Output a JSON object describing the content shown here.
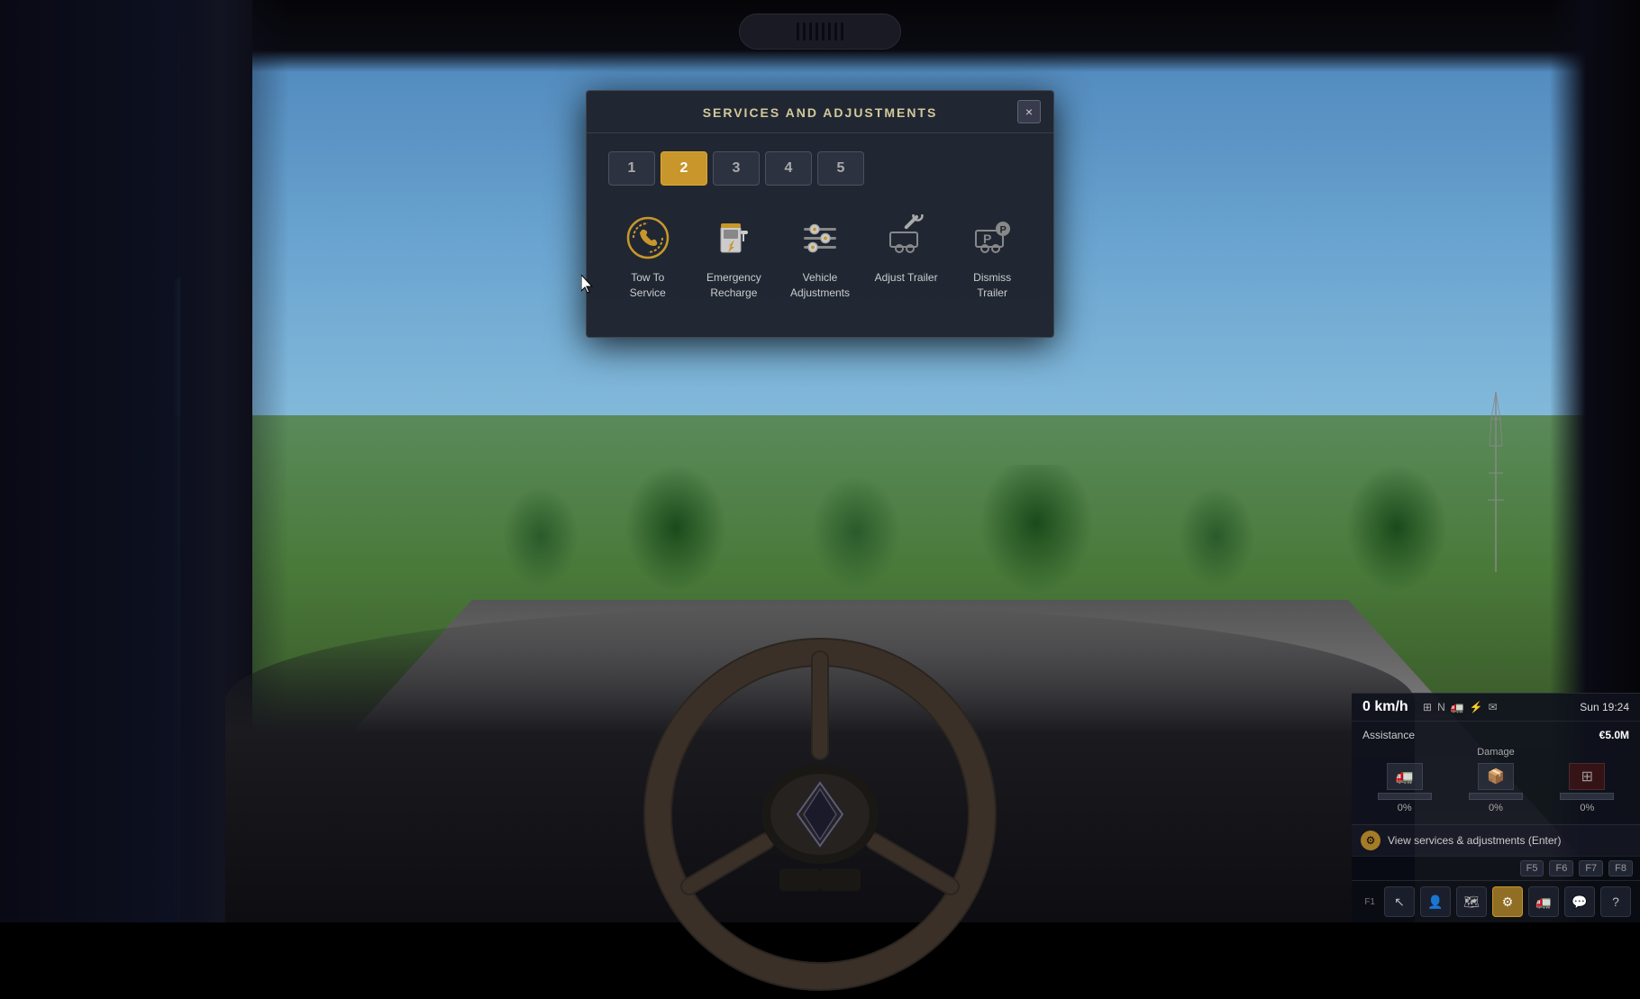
{
  "scene": {
    "background_description": "Truck interior cab view, highway scene"
  },
  "modal": {
    "title": "SERVICES AND ADJUSTMENTS",
    "close_btn": "×",
    "tabs": [
      {
        "number": "1",
        "active": false
      },
      {
        "number": "2",
        "active": true
      },
      {
        "number": "3",
        "active": false
      },
      {
        "number": "4",
        "active": false
      },
      {
        "number": "5",
        "active": false
      }
    ],
    "services": [
      {
        "id": "tow-to-service",
        "label": "Tow To\nService",
        "label_line1": "Tow To",
        "label_line2": "Service",
        "icon": "phone"
      },
      {
        "id": "emergency-recharge",
        "label": "Emergency\nRecharge",
        "label_line1": "Emergency",
        "label_line2": "Recharge",
        "icon": "fuel"
      },
      {
        "id": "vehicle-adjustments",
        "label": "Vehicle\nAdjustments",
        "label_line1": "Vehicle",
        "label_line2": "Adjustments",
        "icon": "adjustments"
      },
      {
        "id": "adjust-trailer",
        "label": "Adjust Trailer",
        "label_line1": "Adjust Trailer",
        "label_line2": "",
        "icon": "trailer"
      },
      {
        "id": "dismiss-trailer",
        "label": "Dismiss\nTrailer",
        "label_line1": "Dismiss",
        "label_line2": "Trailer",
        "icon": "dismiss-trailer"
      }
    ]
  },
  "hud": {
    "speed": "0 km/h",
    "direction": "N",
    "time": "Sun 19:24",
    "assistance_label": "Assistance",
    "assistance_value": "€5.0M",
    "damage_title": "Damage",
    "damage_items": [
      {
        "pct": "0%",
        "type": "truck"
      },
      {
        "pct": "0%",
        "type": "cargo"
      },
      {
        "pct": "0%",
        "type": "trailer"
      }
    ],
    "services_btn_label": "View services & adjustments (Enter)",
    "fkeys": [
      "F5",
      "F6",
      "F7",
      "F8"
    ],
    "toolbar_items": [
      {
        "icon": "cursor-icon",
        "label": "F1",
        "active": false
      },
      {
        "icon": "person-icon",
        "label": "",
        "active": false
      },
      {
        "icon": "map-icon",
        "label": "",
        "active": false
      },
      {
        "icon": "gear-icon",
        "label": "",
        "active": true
      },
      {
        "icon": "truck-icon",
        "label": "",
        "active": false
      },
      {
        "icon": "chat-icon",
        "label": "",
        "active": false
      },
      {
        "icon": "help-icon",
        "label": "",
        "active": false
      }
    ]
  },
  "colors": {
    "active_tab": "#c8962a",
    "modal_bg": "rgba(30,35,45,0.97)",
    "text_primary": "#ccc",
    "text_accent": "#d4c89a",
    "damage_red": "#c0392b"
  }
}
